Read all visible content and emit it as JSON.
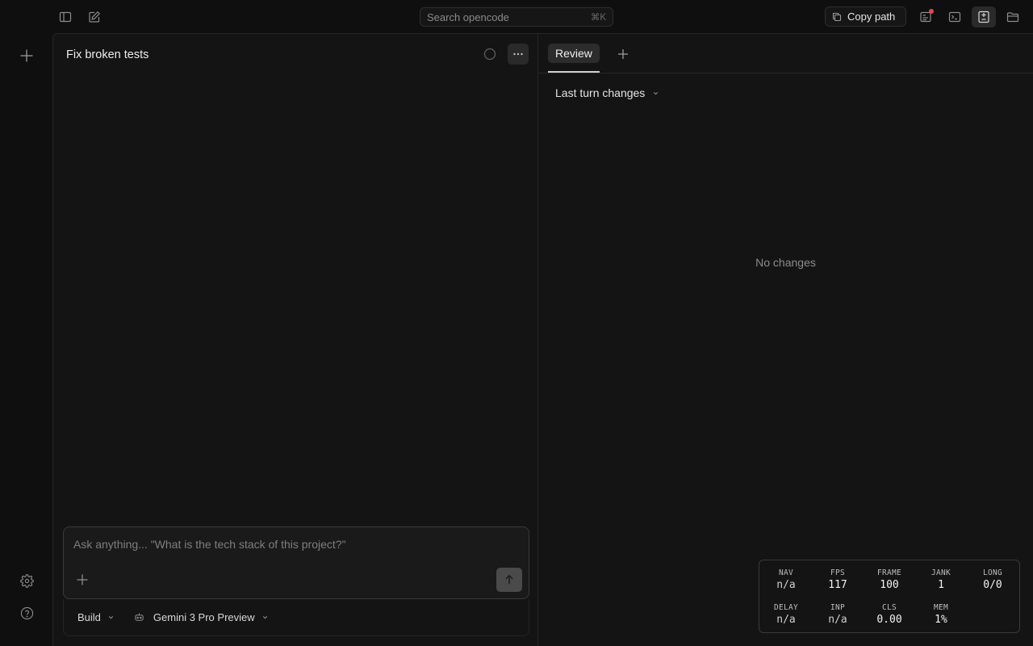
{
  "topbar": {
    "search_placeholder": "Search opencode",
    "search_shortcut": "⌘K",
    "copy_path_label": "Copy path",
    "notification_color": "#e5484d"
  },
  "session": {
    "title": "Fix broken tests"
  },
  "composer": {
    "placeholder": "Ask anything... \"What is the tech stack of this project?\"",
    "value": "",
    "mode_label": "Build",
    "model_label": "Gemini 3 Pro Preview"
  },
  "review": {
    "tab_label": "Review",
    "changes_selector": "Last turn changes",
    "empty_message": "No changes"
  },
  "perf": {
    "row1": [
      {
        "key": "NAV",
        "value": "n/a"
      },
      {
        "key": "FPS",
        "value": "117"
      },
      {
        "key": "FRAME",
        "value": "100"
      },
      {
        "key": "JANK",
        "value": "1"
      },
      {
        "key": "LONG",
        "value": "0/0"
      }
    ],
    "row2": [
      {
        "key": "DELAY",
        "value": "n/a"
      },
      {
        "key": "INP",
        "value": "n/a"
      },
      {
        "key": "CLS",
        "value": "0.00"
      },
      {
        "key": "MEM",
        "value": "1%"
      }
    ]
  }
}
